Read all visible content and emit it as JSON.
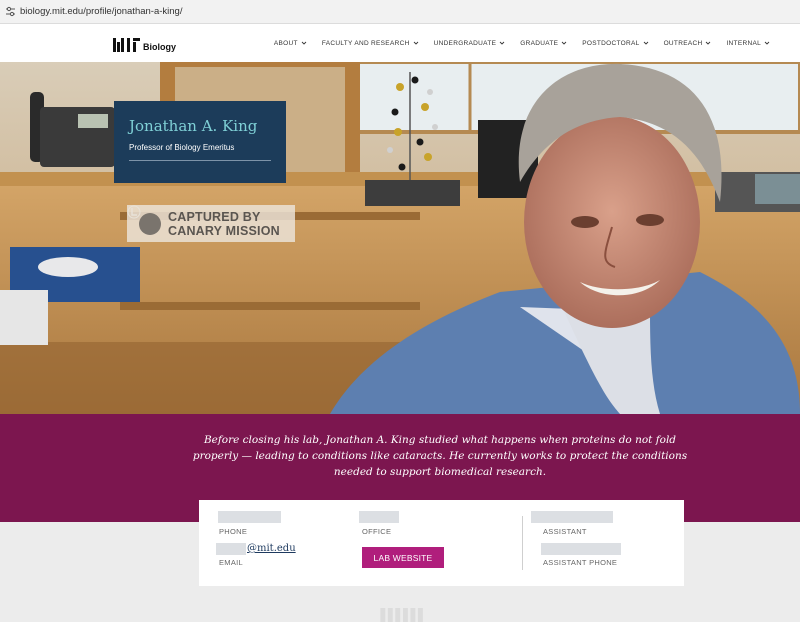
{
  "browser": {
    "url": "biology.mit.edu/profile/jonathan-a-king/"
  },
  "header": {
    "logo_text": "Biology",
    "nav": [
      {
        "label": "ABOUT"
      },
      {
        "label": "FACULTY AND RESEARCH"
      },
      {
        "label": "UNDERGRADUATE"
      },
      {
        "label": "GRADUATE"
      },
      {
        "label": "POSTDOCTORAL"
      },
      {
        "label": "OUTREACH"
      },
      {
        "label": "INTERNAL"
      }
    ]
  },
  "profile": {
    "name": "Jonathan A. King",
    "title": "Professor of Biology Emeritus"
  },
  "watermark": {
    "line1": "CAPTURED BY",
    "line2": "CANARY MISSION"
  },
  "summary": {
    "text": "Before closing his lab, Jonathan A. King studied what happens when proteins do not fold properly — leading to conditions like cataracts. He currently works to protect the conditions needed to support biomedical research."
  },
  "contact": {
    "phone_label": "PHONE",
    "office_label": "OFFICE",
    "email_label": "EMAIL",
    "email_value": "@mit.edu",
    "assistant_label": "ASSISTANT",
    "assistant_phone_label": "ASSISTANT PHONE",
    "lab_button": "LAB WEBSITE"
  },
  "colors": {
    "band": "#7c164f",
    "name_card": "#1c3c5a",
    "name_text": "#7fd0d6",
    "button": "#b01e7c"
  }
}
